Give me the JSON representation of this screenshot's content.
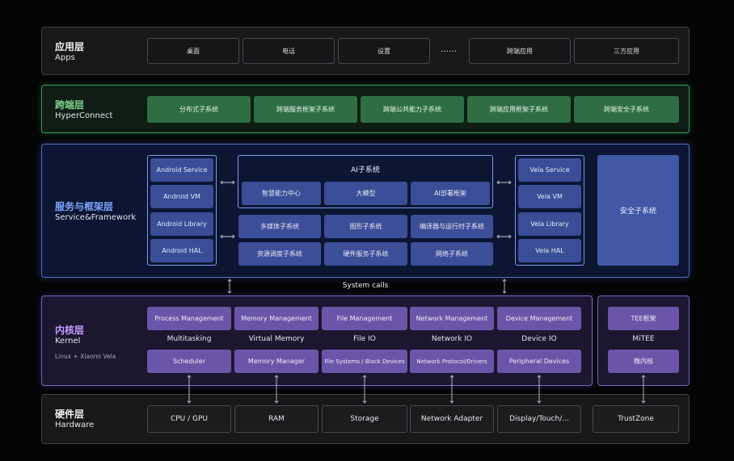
{
  "apps": {
    "title_zh": "应用层",
    "title_en": "Apps",
    "items": [
      "桌面",
      "电话",
      "设置",
      "……",
      "跨端应用",
      "三方应用"
    ]
  },
  "hyperconnect": {
    "title_zh": "跨端层",
    "title_en": "HyperConnect",
    "items": [
      "分布式子系统",
      "跨端服务框架子系统",
      "跨端公共能力子系统",
      "跨端应用框架子系统",
      "跨端安全子系统"
    ]
  },
  "service": {
    "title_zh": "服务与框架层",
    "title_en": "Service&Framework",
    "android": [
      "Android Service",
      "Android VM",
      "Android Library",
      "Android HAL"
    ],
    "ai_title": "AI子系统",
    "ai_items": [
      "智慧能力中心",
      "大模型",
      "AI部署框架"
    ],
    "middle": [
      "多媒体子系统",
      "图形子系统",
      "编译器与运行时子系统",
      "资源调度子系统",
      "硬件服务子系统",
      "网络子系统"
    ],
    "vela": [
      "Vela Service",
      "Vela VM",
      "Vela Library",
      "Vela HAL"
    ],
    "security": "安全子系统"
  },
  "system_calls": "System calls",
  "kernel": {
    "title_zh": "内核层",
    "title_en": "Kernel",
    "subtitle": "Linux + Xiaomi Vela",
    "top": [
      "Process Management",
      "Memory Management",
      "File Management",
      "Network Management",
      "Device Management"
    ],
    "middle": [
      "Multitasking",
      "Virtual Memory",
      "File IO",
      "Network IO",
      "Device IO"
    ],
    "bottom": [
      "Scheduler",
      "Memory Manager",
      "File Systems / Block Devices",
      "Network Protocol/Drivers",
      "Peripheral Devices"
    ]
  },
  "tee": {
    "top": "TEE框架",
    "middle": "MiTEE",
    "bottom": "微内核"
  },
  "hardware": {
    "title_zh": "硬件层",
    "title_en": "Hardware",
    "items": [
      "CPU / GPU",
      "RAM",
      "Storage",
      "Network Adapter",
      "Display/Touch/...",
      "TrustZone"
    ]
  },
  "colors": {
    "background": "#050506",
    "hyperconnect_accent": "#3f9a58",
    "hyperconnect_title": "#7ed38f",
    "service_accent": "#4e6ec4",
    "service_title": "#7fa6ff",
    "kernel_accent": "#7a62c6",
    "kernel_title": "#c69cff"
  }
}
